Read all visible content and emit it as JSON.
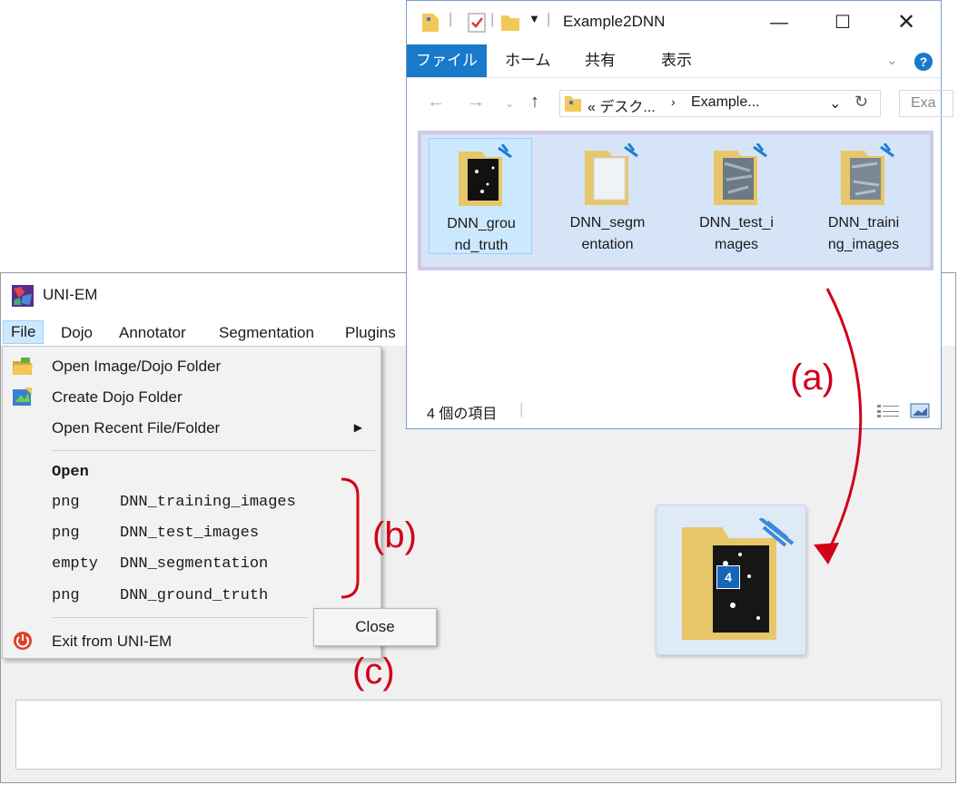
{
  "uniem": {
    "title": "UNI-EM",
    "menu": [
      "File",
      "Dojo",
      "Annotator",
      "Segmentation",
      "Plugins"
    ]
  },
  "file_menu": {
    "open_folder": "Open Image/Dojo Folder",
    "create_folder": "Create Dojo Folder",
    "open_recent": "Open Recent File/Folder",
    "open_header": "Open",
    "open_items": [
      {
        "type": "png",
        "name": "DNN_training_images"
      },
      {
        "type": "png",
        "name": "DNN_test_images"
      },
      {
        "type": "empty",
        "name": "DNN_segmentation"
      },
      {
        "type": "png",
        "name": "DNN_ground_truth"
      }
    ],
    "exit": "Exit from UNI-EM"
  },
  "close_button": "Close",
  "explorer": {
    "title": "Example2DNN",
    "tabs": [
      "ファイル",
      "ホーム",
      "共有",
      "表示"
    ],
    "address": [
      "« デスク...",
      "Example..."
    ],
    "search_placeholder": "Exa",
    "files": [
      {
        "line1": "DNN_grou",
        "line2": "nd_truth"
      },
      {
        "line1": "DNN_segm",
        "line2": "entation"
      },
      {
        "line1": "DNN_test_i",
        "line2": "mages"
      },
      {
        "line1": "DNN_traini",
        "line2": "ng_images"
      }
    ],
    "status": "4 個の項目"
  },
  "drag_badge": "4",
  "annotations": {
    "a": "(a)",
    "b": "(b)",
    "c": "(c)"
  },
  "colors": {
    "accent": "#1979ca",
    "annotation": "#d0021b",
    "selection": "#cce8ff"
  }
}
